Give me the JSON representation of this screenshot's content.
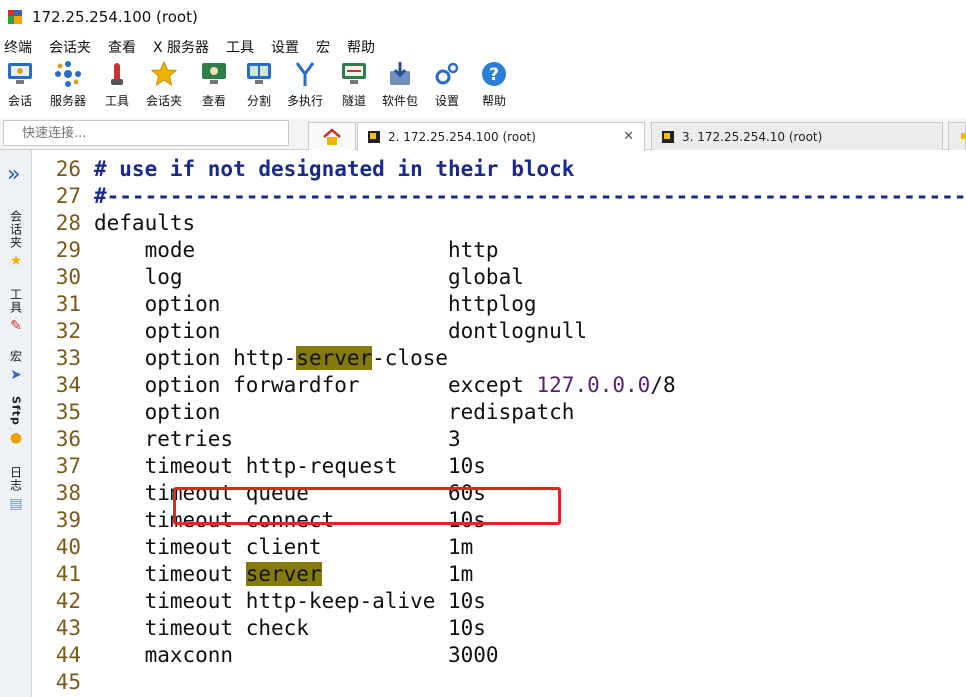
{
  "window": {
    "title": "172.25.254.100 (root)"
  },
  "menu": [
    "终端",
    "会话夹",
    "查看",
    "X 服务器",
    "工具",
    "设置",
    "宏",
    "帮助"
  ],
  "toolbar": [
    {
      "label": "会话",
      "icon": "session-icon"
    },
    {
      "label": "服务器",
      "icon": "servers-icon"
    },
    {
      "label": "工具",
      "icon": "tools-icon"
    },
    {
      "label": "会话夹",
      "icon": "star-icon"
    },
    {
      "label": "查看",
      "icon": "view-icon"
    },
    {
      "label": "分割",
      "icon": "split-icon"
    },
    {
      "label": "多执行",
      "icon": "multiexec-icon"
    },
    {
      "label": "隧道",
      "icon": "tunnel-icon"
    },
    {
      "label": "软件包",
      "icon": "packages-icon"
    },
    {
      "label": "设置",
      "icon": "settings-icon"
    },
    {
      "label": "帮助",
      "icon": "help-icon"
    }
  ],
  "quick_connect": {
    "placeholder": "快速连接..."
  },
  "tabs": [
    {
      "label": "2. 172.25.254.100 (root)",
      "active": true
    },
    {
      "label": "3. 172.25.254.10 (root)",
      "active": false
    }
  ],
  "sidebar": {
    "groups": [
      {
        "label": "会话夹",
        "icon": "star-icon"
      },
      {
        "label": "工具",
        "icon": "tools-icon"
      },
      {
        "label": "宏",
        "icon": "macro-icon"
      },
      {
        "label": "Sftp",
        "icon": "sftp-icon"
      },
      {
        "label": "日志",
        "icon": "log-icon"
      }
    ]
  },
  "terminal": {
    "highlight_color": "#857b0c",
    "lines": [
      {
        "num": "26",
        "text": "# use if not designated in their block"
      },
      {
        "num": "27",
        "text": "#---------------------------------------------------------------------"
      },
      {
        "num": "28",
        "text": "defaults"
      },
      {
        "num": "29",
        "text": "    mode                    http"
      },
      {
        "num": "30",
        "text": "    log                     global"
      },
      {
        "num": "31",
        "text": "    option                  httplog"
      },
      {
        "num": "32",
        "text": "    option                  dontlognull"
      },
      {
        "num": "33",
        "text": "    option http-server-close"
      },
      {
        "num": "34",
        "text": "    option forwardfor       except 127.0.0.0/8"
      },
      {
        "num": "35",
        "text": "    option                  redispatch"
      },
      {
        "num": "36",
        "text": "    retries                 3"
      },
      {
        "num": "37",
        "text": "    timeout http-request    10s"
      },
      {
        "num": "38",
        "text": "    timeout queue           60s"
      },
      {
        "num": "39",
        "text": "    timeout connect         10s"
      },
      {
        "num": "40",
        "text": "    timeout client          1m"
      },
      {
        "num": "41",
        "text": "    timeout server          1m"
      },
      {
        "num": "42",
        "text": "    timeout http-keep-alive 10s"
      },
      {
        "num": "43",
        "text": "    timeout check           10s"
      },
      {
        "num": "44",
        "text": "    maxconn                 3000"
      },
      {
        "num": "45",
        "text": ""
      }
    ]
  }
}
